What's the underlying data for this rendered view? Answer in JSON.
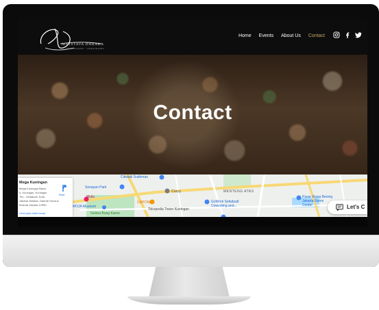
{
  "site": {
    "logo_text": "MATSTAVA DARAKA",
    "logo_subtext": "PHOTOGRAPHY · VIDEOGRAPHY",
    "nav": [
      {
        "label": "Home"
      },
      {
        "label": "Events"
      },
      {
        "label": "About Us"
      },
      {
        "label": "Contact"
      }
    ],
    "active_nav": "Contact",
    "social_icons": [
      "instagram-icon",
      "facebook-icon",
      "twitter-icon"
    ]
  },
  "hero": {
    "title": "Contact"
  },
  "map": {
    "info_card": {
      "title": "Mega Kuningan",
      "lines": [
        "Mega Kuningan Barat",
        "II, Kuningan, Kuningan",
        "Tim., Setiabudi, Kota",
        "Jakarta Selatan, Daerah Khusus",
        "Ibukota Jakarta 12950"
      ],
      "link": "Lihat peta lebih besar",
      "route_label": "Rute"
    },
    "labels": {
      "citiwalk": "Citiwalk Sudirman",
      "senayan": "Senayan Park",
      "cozzy": "Cozzy",
      "capital": "CAPITAL",
      "menteng": "MENTENG ATAS",
      "gowork": "GoWork Setiabudi Coworking and...",
      "tokopedia": "Tokopedia Tower Kuningan",
      "pasar": "Pasar Rawa Bening Jakarta Gems Center",
      "moja": "MOJA Museum",
      "mulia": "Mulia",
      "gelora": "Gelora Bung Karno"
    }
  },
  "chat": {
    "label": "Let's C"
  },
  "colors": {
    "active_nav": "#c8a96a",
    "nav_text": "#ffffff",
    "map_bg": "#eef0ee",
    "road_yellow": "#f7d874",
    "park_green": "#bde5c0",
    "water": "#aadaff"
  }
}
